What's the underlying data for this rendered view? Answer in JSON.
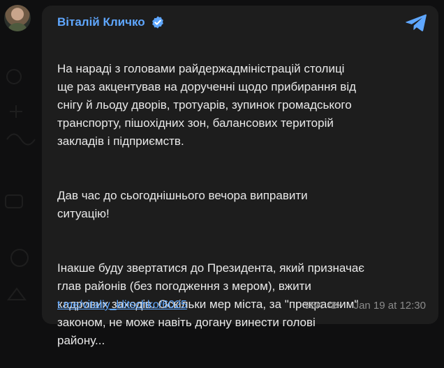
{
  "post": {
    "author": "Віталій Кличко",
    "paragraphs": [
      "На нараді з головами райдержадміністрацій столиці\nще раз акцентував на дорученні щодо прибирання від\nснігу й льоду дворів, тротуарів, зупинок громадського\nтранспорту, пішохідних зон, балансових територій\nзакладів і підприємств.",
      "Дав час до сьогоднішнього вечора виправити\nситуацію!",
      "Інакше буду звертатися до Президента, який призначає\nглав районів (без погодження з мером), вжити\nкадрових заходів. Оскільки мер міста, за \"прекрасним\"\nзаконом, не може навіть догану винести голові\nрайону..."
    ],
    "link": "t.me/vitaliy_klitschko/6025",
    "views": "95K",
    "date": "Jan 19 at 12:30"
  },
  "icons": {
    "verified": "verified-badge-icon",
    "telegram": "telegram-plane-icon",
    "views": "eye-icon"
  },
  "colors": {
    "accent": "#5fa7ff",
    "card_bg": "#1d1d1d",
    "page_bg": "#0f0f10",
    "text": "#e9e9e9",
    "meta": "#8b8b8b"
  }
}
